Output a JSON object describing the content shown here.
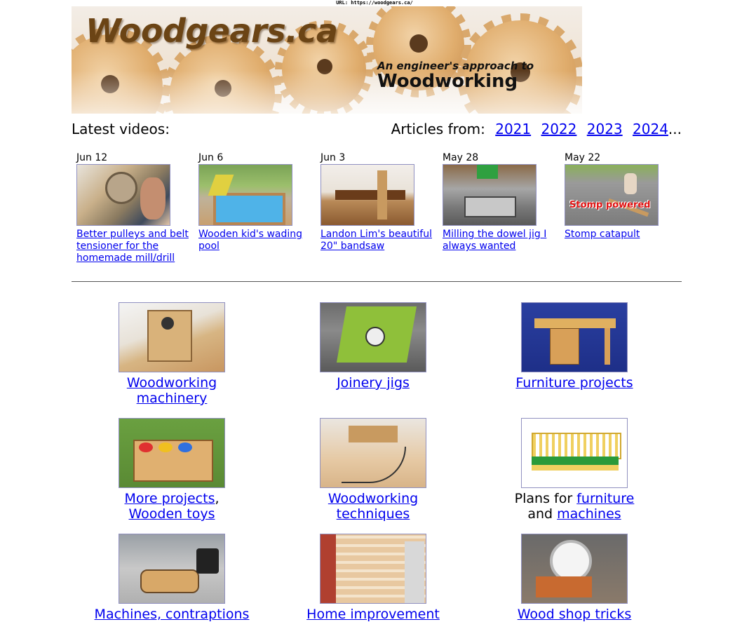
{
  "url_bar": "URL: https://woodgears.ca/",
  "banner": {
    "logo": "Woodgears.ca",
    "tagline_small": "An engineer's approach to",
    "tagline_big": "Woodworking"
  },
  "latest": {
    "label": "Latest videos:",
    "articles_label": "Articles from:",
    "years": [
      "2021",
      "2022",
      "2023",
      "2024"
    ],
    "years_suffix": "..."
  },
  "videos": [
    {
      "date": "Jun 12",
      "title": "Better pulleys and belt tensioner for the homemade mill/drill"
    },
    {
      "date": "Jun 6",
      "title": "Wooden kid's wading pool"
    },
    {
      "date": "Jun 3",
      "title": "Landon Lim's beautiful 20\" bandsaw"
    },
    {
      "date": "May 28",
      "title": "Milling the dowel jig I always wanted"
    },
    {
      "date": "May 22",
      "title": "Stomp catapult",
      "overlay": "Stomp powered"
    }
  ],
  "categories": {
    "woodworking_machinery": {
      "line1": "Woodworking",
      "line2": "machinery"
    },
    "joinery_jigs": {
      "line1": "Joinery jigs"
    },
    "furniture_projects": {
      "line1": "Furniture projects"
    },
    "more_projects": {
      "link1": "More projects",
      "sep": ",",
      "link2": "Wooden toys"
    },
    "techniques": {
      "line1": "Woodworking",
      "line2": "techniques"
    },
    "plans": {
      "prefix": "Plans for",
      "link1": "furniture",
      "and": "and",
      "link2": "machines"
    },
    "machines": {
      "line1": "Machines, contraptions"
    },
    "home_improvement": {
      "line1": "Home improvement"
    },
    "shop_tricks": {
      "line1": "Wood shop tricks"
    }
  }
}
